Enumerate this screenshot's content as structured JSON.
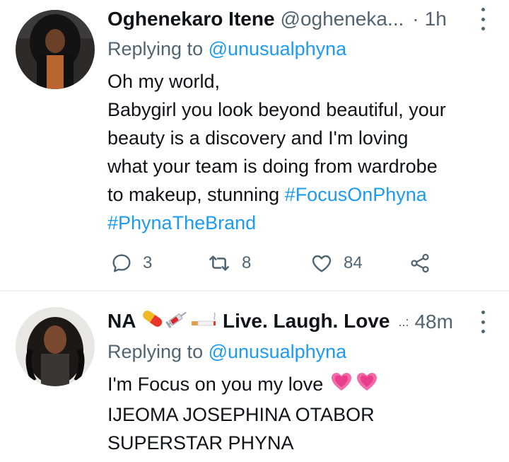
{
  "tweets": [
    {
      "display_name": "Oghenekaro Itene",
      "handle": "@ogheneka...",
      "separator": "·",
      "time": "1h",
      "replying_to_label": "Replying to",
      "replying_to_handle": "@unusualphyna",
      "body_lines": [
        "Oh my world,",
        "Babygirl you look beyond beautiful, your",
        "beauty is a discovery and I'm loving",
        "what your team is doing from wardrobe",
        "to makeup, stunning "
      ],
      "hashtags": [
        "#FocusOnPhyna",
        "#PhynaTheBrand"
      ],
      "actions": {
        "replies": "3",
        "retweets": "8",
        "likes": "84"
      },
      "icons": [
        "reply-icon",
        "retweet-icon",
        "like-icon",
        "share-icon",
        "more-icon"
      ]
    },
    {
      "display_name_prefix": "NA ",
      "display_name_suffix": "Live. Laugh. Love",
      "name_emojis": [
        "pill-emoji",
        "syringe-emoji",
        "cigarette-emoji"
      ],
      "separator": "..:",
      "time": "48m",
      "replying_to_label": "Replying to",
      "replying_to_handle": "@unusualphyna",
      "body_lines": [
        "I'm Focus on you my love ",
        "IJEOMA JOSEPHINA OTABOR",
        "SUPERSTAR PHYNA"
      ],
      "body_emojis": [
        "beating-heart-emoji",
        "beating-heart-emoji"
      ]
    }
  ],
  "colors": {
    "accent": "#1d9bf0",
    "secondary_text": "#536471",
    "primary_text": "#0f1419",
    "divider": "#eff3f4"
  }
}
